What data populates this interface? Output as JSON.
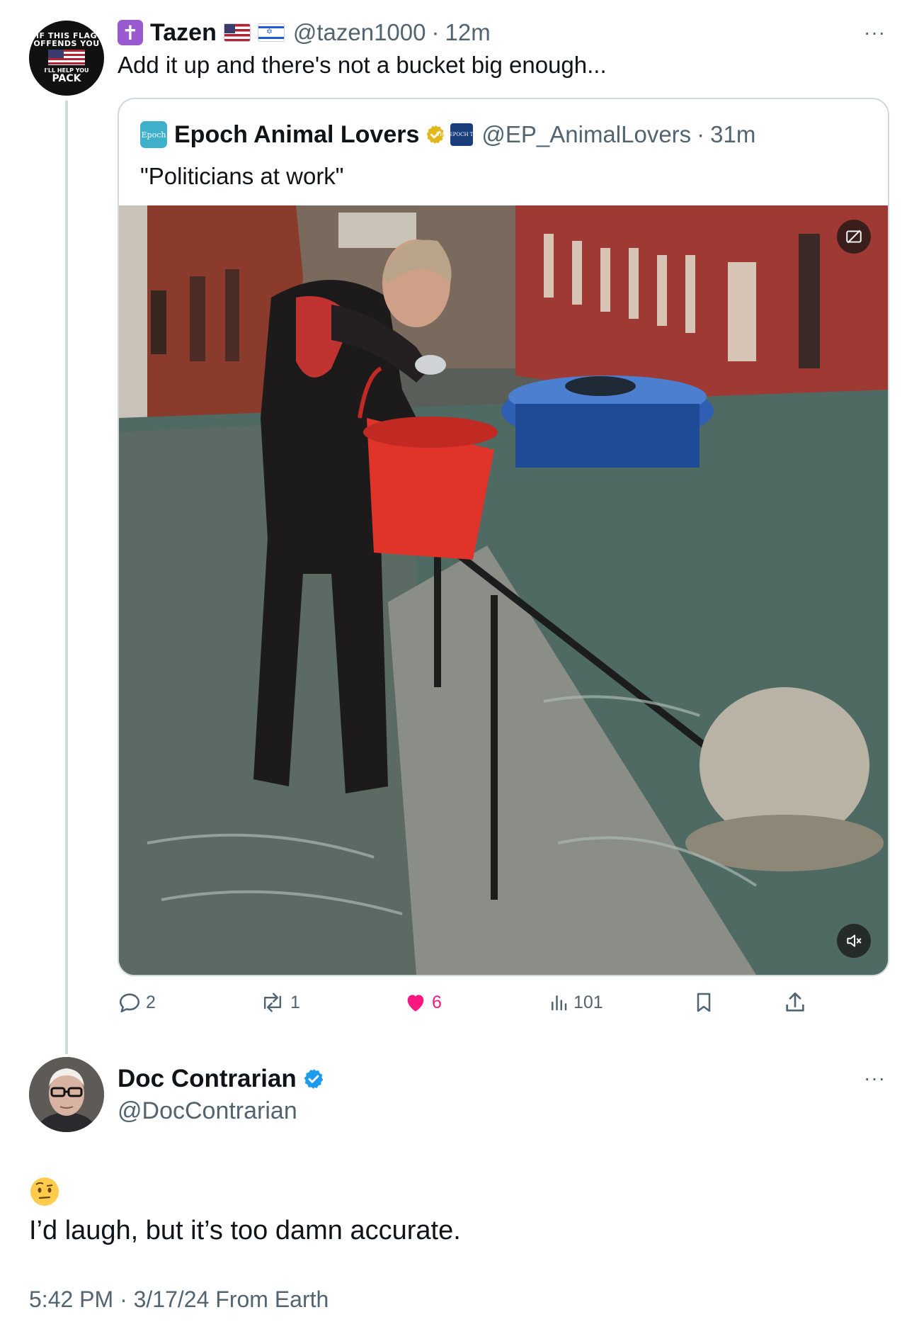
{
  "tweet": {
    "avatar_text": [
      "IF THIS FLAG",
      "OFFENDS YOU",
      "I'LL HELP YOU",
      "PACK"
    ],
    "name_badge_icon": "latin-cross-icon",
    "name": "Tazen",
    "flags": [
      "us-flag",
      "israel-flag"
    ],
    "handle": "@tazen1000",
    "separator": "·",
    "time": "12m",
    "text": "Add it up and there's not a bucket big enough...",
    "more": "···"
  },
  "quote": {
    "avatar_text": "Epoch",
    "name": "Epoch Animal Lovers",
    "affiliate_text": "THE EPOCH TIMES",
    "handle": "@EP_AnimalLovers",
    "separator": "·",
    "time": "31m",
    "text": "\"Politicians at work\"",
    "media_description_icons": [
      "captions-off-icon",
      "muted-speaker-icon"
    ]
  },
  "actions": {
    "replies": "2",
    "reposts": "1",
    "likes": "6",
    "views": "101",
    "like_color": "#f91880"
  },
  "reply": {
    "name": "Doc Contrarian",
    "handle": "@DocContrarian",
    "emoji": "face-with-raised-eyebrow",
    "text": "I’d laugh, but it’s too damn accurate.",
    "meta": "5:42 PM · 3/17/24 From Earth",
    "more": "···"
  },
  "colors": {
    "text_primary": "#0f1419",
    "text_secondary": "#536471",
    "border": "#cfd9de",
    "verified_blue": "#1d9bf0",
    "verified_gold": "#e2b719"
  }
}
